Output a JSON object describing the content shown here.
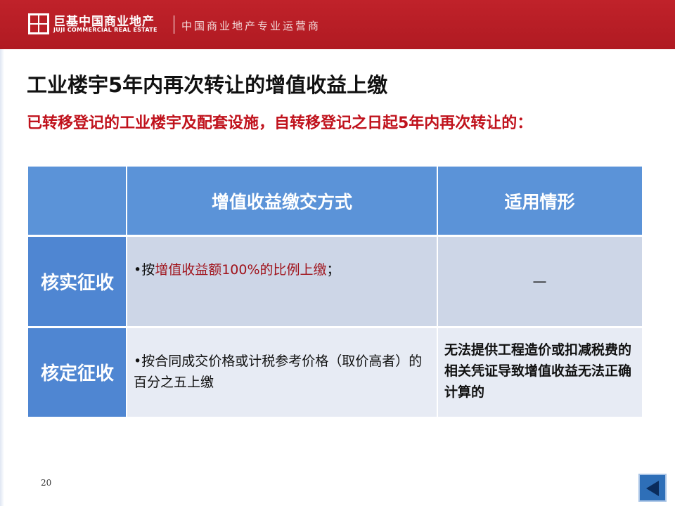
{
  "header": {
    "logo_cn": "巨基中国商业地产",
    "logo_en": "JUJI COMMERCIAL REAL ESTATE",
    "slogan": "中国商业地产专业运营商"
  },
  "title": "工业楼宇5年内再次转让的增值收益上缴",
  "subtitle": "已转移登记的工业楼宇及配套设施，自转移登记之日起5年内再次转让的：",
  "table": {
    "headers": [
      "",
      "增值收益缴交方式",
      "适用情形"
    ],
    "rows": [
      {
        "label": "核实征收",
        "method_prefix": "•按",
        "method_highlight": "增值收益额100%的比例上缴",
        "method_suffix": "；",
        "situation": "—"
      },
      {
        "label": "核定征收",
        "method": "•按合同成交价格或计税参考价格（取价高者）的百分之五上缴",
        "situation": "无法提供工程造价或扣减税费的相关凭证导致增值收益无法正确计算的"
      }
    ]
  },
  "page_number": "20",
  "colors": {
    "header_red": "#b91d24",
    "table_header_blue": "#5b93d8",
    "highlight_red": "#a0131b"
  },
  "icons": {
    "nav_back": "triangle-left-icon"
  }
}
